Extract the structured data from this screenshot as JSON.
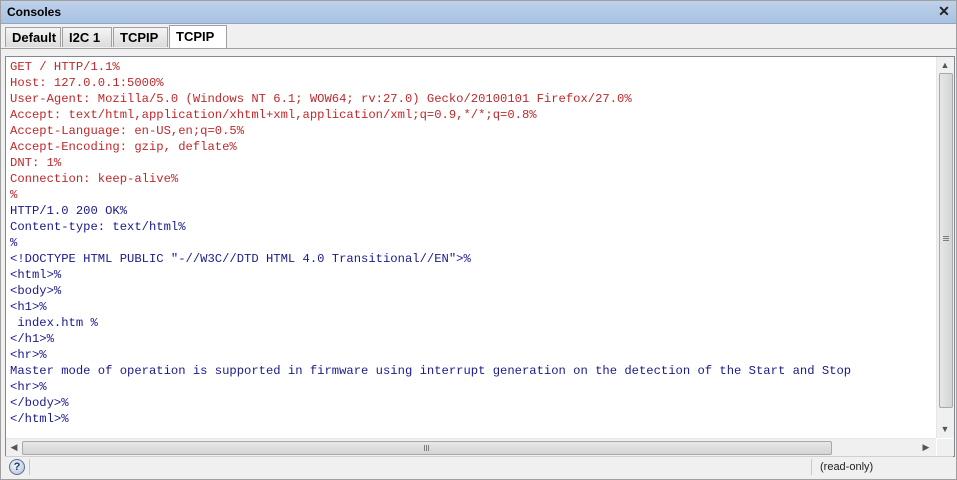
{
  "window": {
    "title": "Consoles"
  },
  "tabs": [
    "Default",
    "I2C 1",
    "TCPIP",
    "TCPIP"
  ],
  "active_tab": 3,
  "console": {
    "lines": [
      {
        "text": "GET / HTTP/1.1%",
        "color": "red"
      },
      {
        "text": "Host: 127.0.0.1:5000%",
        "color": "red"
      },
      {
        "text": "User-Agent: Mozilla/5.0 (Windows NT 6.1; WOW64; rv:27.0) Gecko/20100101 Firefox/27.0%",
        "color": "red"
      },
      {
        "text": "Accept: text/html,application/xhtml+xml,application/xml;q=0.9,*/*;q=0.8%",
        "color": "red"
      },
      {
        "text": "Accept-Language: en-US,en;q=0.5%",
        "color": "red"
      },
      {
        "text": "Accept-Encoding: gzip, deflate%",
        "color": "red"
      },
      {
        "text": "DNT: 1%",
        "color": "red"
      },
      {
        "text": "Connection: keep-alive%",
        "color": "red"
      },
      {
        "text": "%",
        "color": "red"
      },
      {
        "text": "HTTP/1.0 200 OK%",
        "color": "blue"
      },
      {
        "text": "Content-type: text/html%",
        "color": "blue"
      },
      {
        "text": "%",
        "color": "blue"
      },
      {
        "text": "<!DOCTYPE HTML PUBLIC \"-//W3C//DTD HTML 4.0 Transitional//EN\">%",
        "color": "blue"
      },
      {
        "text": "<html>%",
        "color": "blue"
      },
      {
        "text": "<body>%",
        "color": "blue"
      },
      {
        "text": "<h1>%",
        "color": "blue"
      },
      {
        "text": " index.htm %",
        "color": "blue"
      },
      {
        "text": "</h1>%",
        "color": "blue"
      },
      {
        "text": "<hr>%",
        "color": "blue"
      },
      {
        "text": "Master mode of operation is supported in firmware using interrupt generation on the detection of the Start and Stop",
        "color": "blue"
      },
      {
        "text": "<hr>%",
        "color": "blue"
      },
      {
        "text": "</body>%",
        "color": "blue"
      },
      {
        "text": "</html>%",
        "color": "blue"
      }
    ]
  },
  "colors": {
    "red": "#c0282b",
    "blue": "#1a1a8c"
  },
  "status": {
    "mode": "(read-only)",
    "help_icon": "?"
  }
}
